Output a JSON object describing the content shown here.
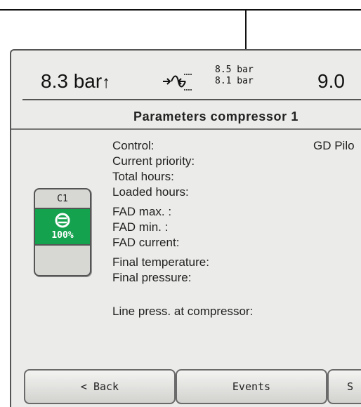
{
  "status": {
    "pressure_main": "8.3 bar",
    "pressure_trend": "↑",
    "band_high": "8.5 bar",
    "band_low": "8.1 bar",
    "pressure_right": "9.0",
    "band_icon": "pressure-band-icon"
  },
  "title": "Parameters compressor 1",
  "compressor": {
    "id": "C1",
    "load": "100%",
    "status_color": "#15a24f",
    "icon": "running-icon"
  },
  "parameters": [
    "Control:",
    "Current priority:",
    "Total hours:",
    "Loaded hours:",
    "FAD max. :",
    "FAD min. :",
    "FAD current:",
    "Final temperature:",
    "Final pressure:",
    "Line press. at compressor:"
  ],
  "control_value": "GD Pilo",
  "buttons": {
    "back": "< Back",
    "events": "Events",
    "third": "S"
  }
}
